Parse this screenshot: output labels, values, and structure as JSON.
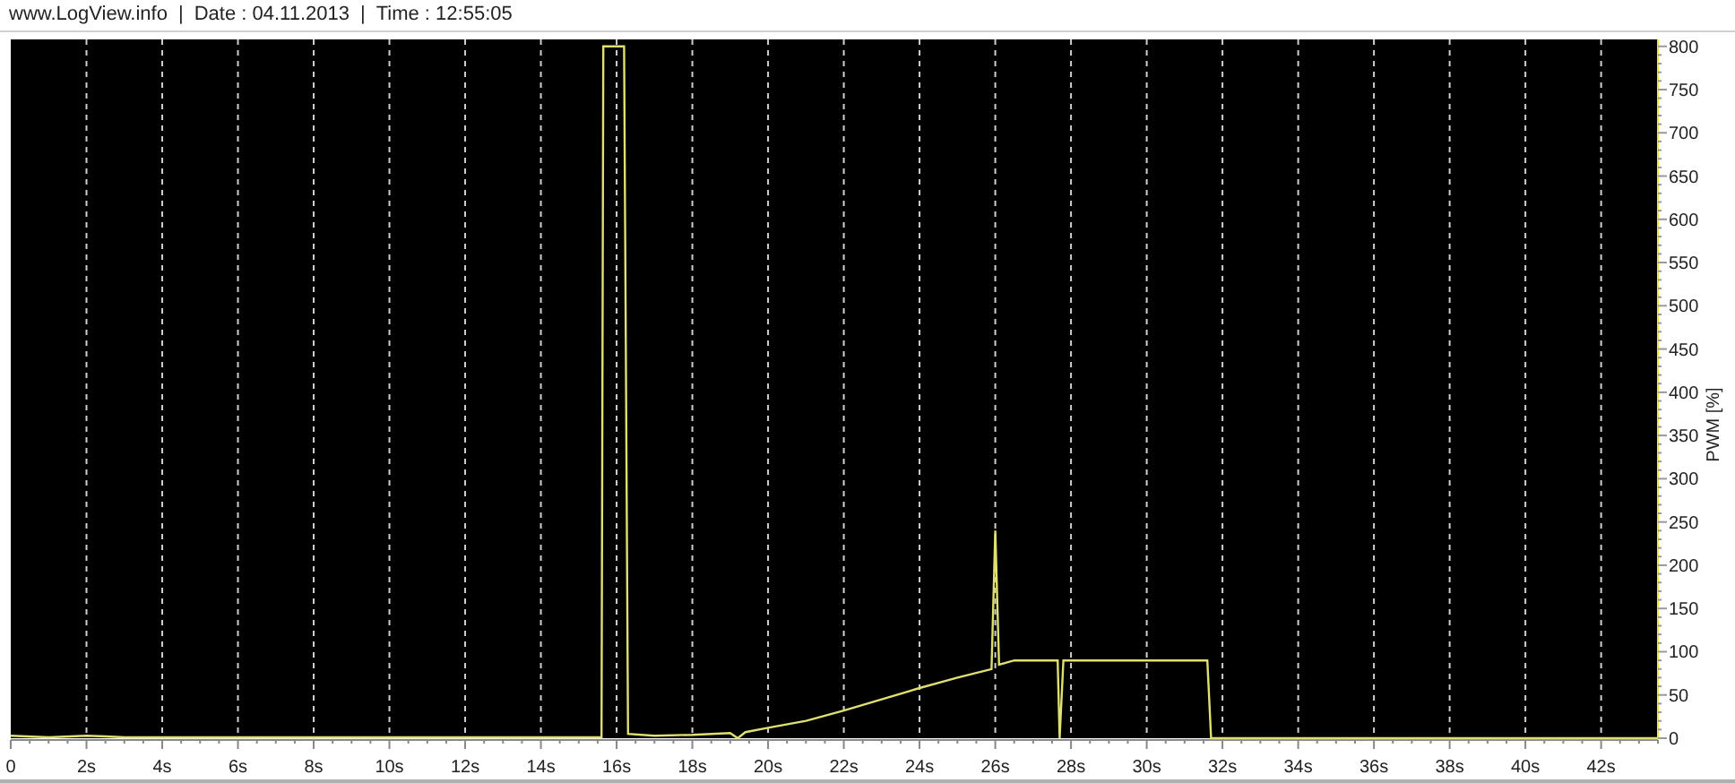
{
  "header": {
    "items": [
      "www.LogView.info",
      "|",
      "Date : 04.11.2013",
      "|",
      "Time : 12:55:05"
    ]
  },
  "chart_data": {
    "type": "line",
    "grid": true,
    "ylabel": "PWM [%]",
    "xlim": [
      0,
      43.5
    ],
    "ylim": [
      0,
      808
    ],
    "xticks": [
      0,
      {
        "value": 2,
        "label": "2s"
      },
      {
        "value": 4,
        "label": "4s"
      },
      {
        "value": 6,
        "label": "6s"
      },
      {
        "value": 8,
        "label": "8s"
      },
      {
        "value": 10,
        "label": "10s"
      },
      {
        "value": 12,
        "label": "12s"
      },
      {
        "value": 14,
        "label": "14s"
      },
      {
        "value": 16,
        "label": "16s"
      },
      {
        "value": 18,
        "label": "18s"
      },
      {
        "value": 20,
        "label": "20s"
      },
      {
        "value": 22,
        "label": "22s"
      },
      {
        "value": 24,
        "label": "24s"
      },
      {
        "value": 26,
        "label": "26s"
      },
      {
        "value": 28,
        "label": "28s"
      },
      {
        "value": 30,
        "label": "30s"
      },
      {
        "value": 32,
        "label": "32s"
      },
      {
        "value": 34,
        "label": "34s"
      },
      {
        "value": 36,
        "label": "36s"
      },
      {
        "value": 38,
        "label": "38s"
      },
      {
        "value": 40,
        "label": "40s"
      },
      {
        "value": 42,
        "label": "42s"
      }
    ],
    "yticks": [
      0,
      50,
      100,
      150,
      200,
      250,
      300,
      350,
      400,
      450,
      500,
      550,
      600,
      650,
      700,
      750,
      800
    ],
    "x": [
      0,
      1,
      2,
      2.5,
      3,
      15.6,
      15.65,
      16.2,
      16.3,
      17,
      18,
      19,
      19.2,
      19.4,
      20,
      21,
      22,
      23,
      24,
      25,
      25.9,
      26,
      26.1,
      26.5,
      27,
      27.65,
      27.7,
      27.8,
      28,
      30,
      31.6,
      31.7,
      32,
      43.5
    ],
    "values": [
      3,
      1,
      3,
      2,
      1,
      1,
      800,
      800,
      5,
      3,
      4,
      6,
      0,
      7,
      12,
      20,
      32,
      45,
      58,
      70,
      80,
      240,
      85,
      90,
      90,
      90,
      0,
      90,
      90,
      90,
      90,
      0,
      0,
      0
    ]
  }
}
